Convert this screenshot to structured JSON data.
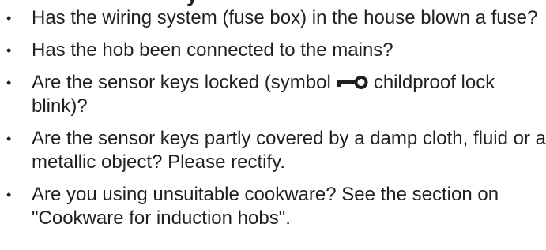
{
  "cutoff_heading": "y",
  "items": [
    {
      "bullet": "•",
      "text": "Has the wiring system (fuse box) in the house blown a fuse?"
    },
    {
      "bullet": "•",
      "text": "Has the hob been connected to the mains?"
    },
    {
      "bullet": "•",
      "text_before": "Are the sensor keys locked (symbol",
      "icon": "childproof-lock-key-icon",
      "text_after": "childproof lock blink)?"
    },
    {
      "bullet": "•",
      "text": "Are the sensor keys partly covered by a damp cloth, fluid or a metallic object? Please rectify."
    },
    {
      "bullet": "•",
      "text": "Are you using unsuitable cookware? See the section on \"Cookware for induction hobs\"."
    }
  ]
}
